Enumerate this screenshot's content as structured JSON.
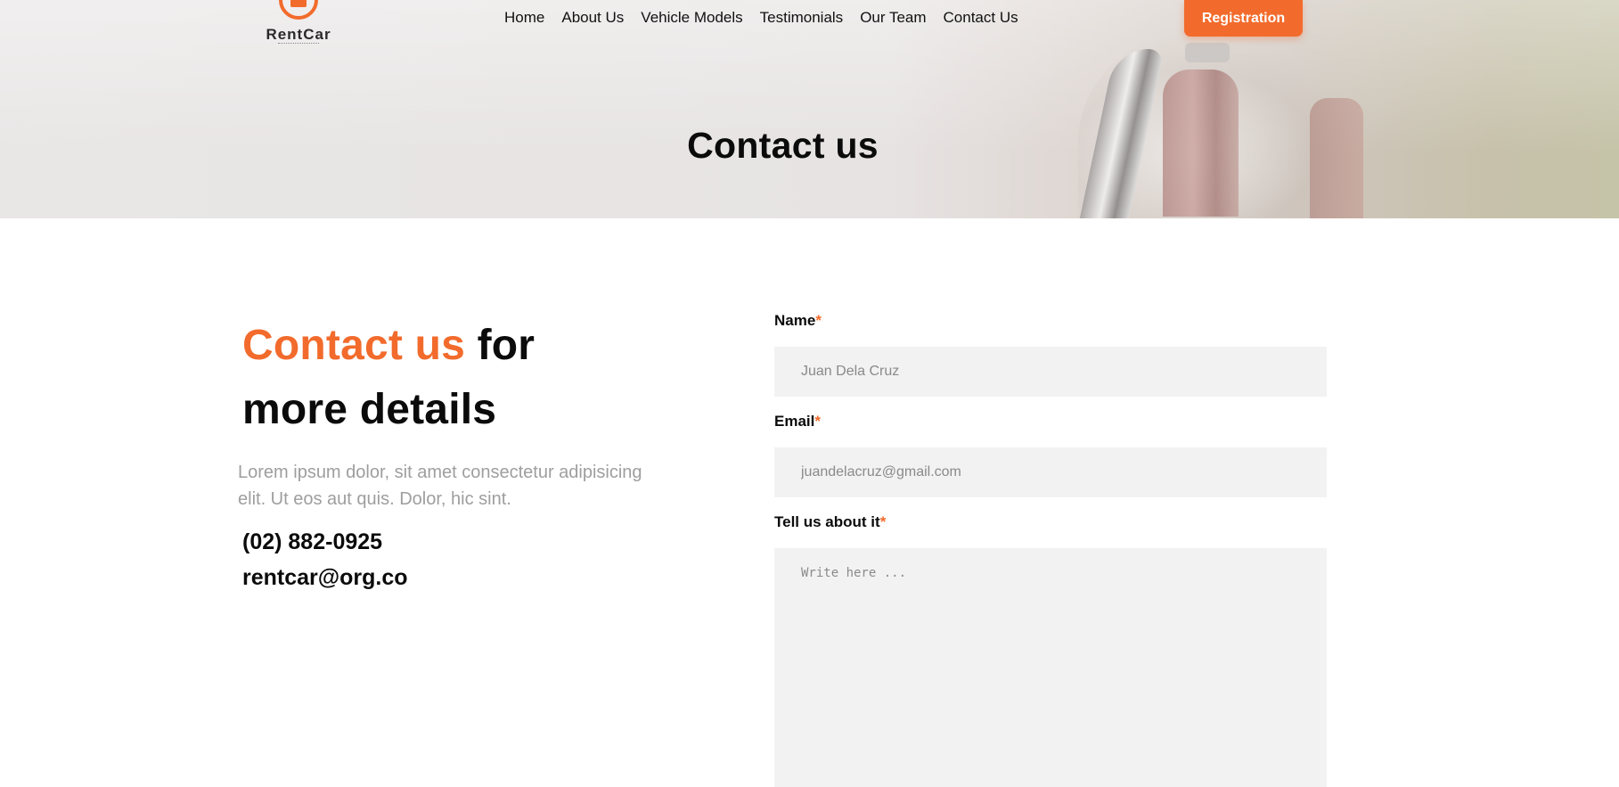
{
  "nav": {
    "brand": "RentCar",
    "items": [
      {
        "label": "Home"
      },
      {
        "label": "About Us"
      },
      {
        "label": "Vehicle Models"
      },
      {
        "label": "Testimonials"
      },
      {
        "label": "Our Team"
      },
      {
        "label": "Contact Us"
      }
    ],
    "register_label": "Registration"
  },
  "hero": {
    "title": "Contact us"
  },
  "contact_info": {
    "heading_accent": "Contact us",
    "heading_rest_1": "for",
    "heading_rest_2": "more details",
    "description": "Lorem ipsum dolor, sit amet consectetur adipisicing elit. Ut eos aut quis. Dolor, hic sint.",
    "phone": "(02) 882-0925",
    "email": "rentcar@org.co"
  },
  "form": {
    "name_label": "Name",
    "name_placeholder": "Juan Dela Cruz",
    "email_label": "Email",
    "email_placeholder": "juandelacruz@gmail.com",
    "message_label": "Tell us about it",
    "message_placeholder": "Write here ...",
    "required_mark": "*"
  },
  "colors": {
    "accent": "#f26b2c",
    "text": "#0b0b0b",
    "muted": "#9e9e9e",
    "field_bg": "#f2f2f2"
  }
}
